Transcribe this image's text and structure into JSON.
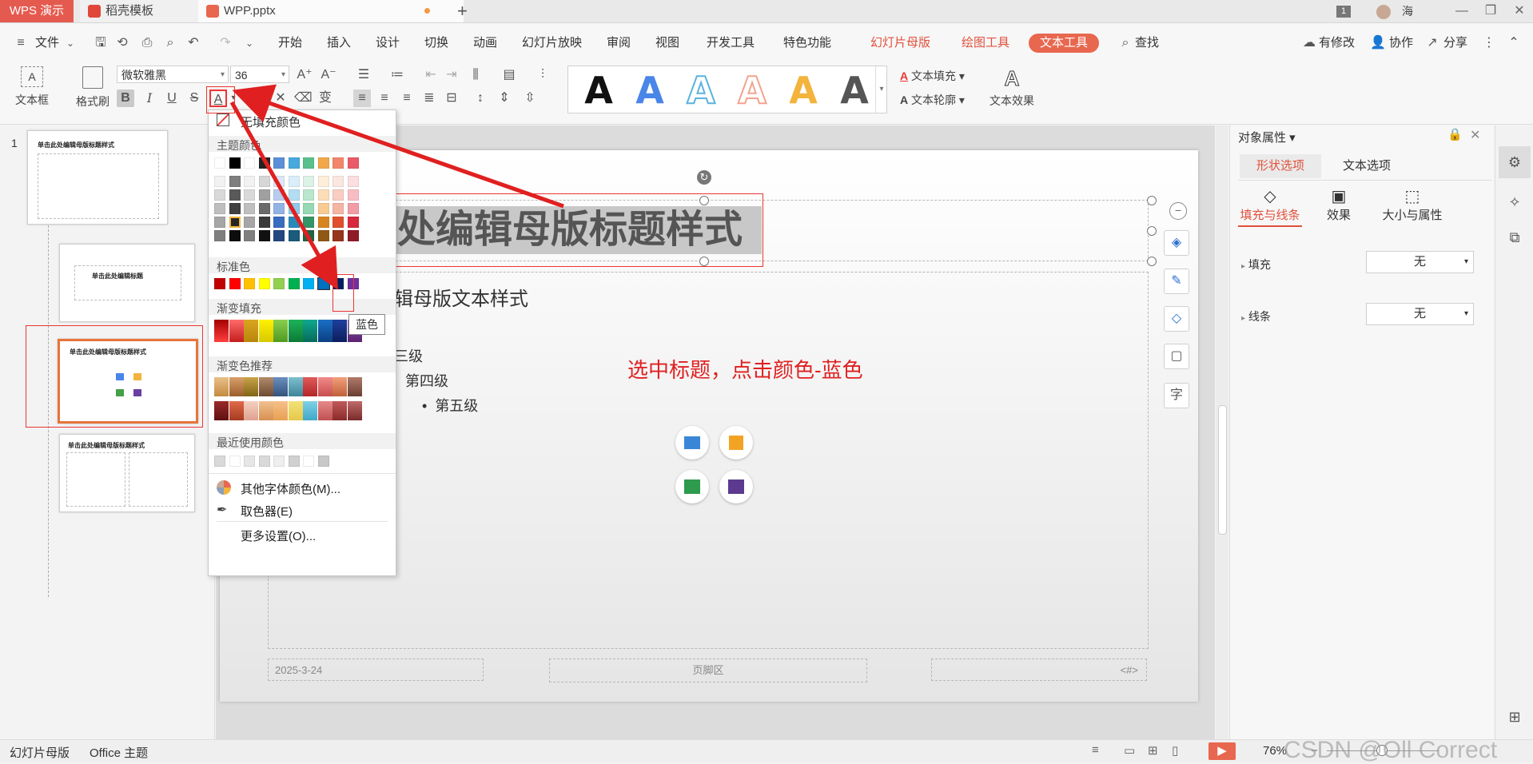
{
  "tabs": {
    "app": "WPS 演示",
    "template": "稻壳模板",
    "file": "WPP.pptx",
    "add": "+",
    "page_badge": "1",
    "user": "海"
  },
  "menu": {
    "file": "文件",
    "items": [
      "开始",
      "插入",
      "设计",
      "切换",
      "动画",
      "幻灯片放映",
      "审阅",
      "视图",
      "开发工具",
      "特色功能"
    ],
    "ctx_master": "幻灯片母版",
    "ctx_draw": "绘图工具",
    "ctx_text": "文本工具",
    "search": "查找",
    "right": [
      "有修改",
      "协作",
      "分享"
    ]
  },
  "ribbon": {
    "textbox": "文本框",
    "format_painter": "格式刷",
    "font_name": "微软雅黑",
    "font_size": "36",
    "bold": "B",
    "italic": "I",
    "underline": "U",
    "strike": "S",
    "font_color_letter": "A",
    "text_fill": "文本填充",
    "text_outline": "文本轮廓",
    "text_effect": "文本效果",
    "style_letter": "A",
    "style_colors": [
      "#111111",
      "#4a86e8",
      "#5bb3e0",
      "#f2a48e",
      "#f3b33d",
      "#555555"
    ]
  },
  "thumbs": {
    "num": "1",
    "master_title": "单击此处编辑母版标题样式",
    "layout2_title": "单击此处编辑标题",
    "layout3_title": "单击此处编辑母版标题样式",
    "layout4_title": "单击此处编辑母版标题样式"
  },
  "slide": {
    "title": "处编辑母版标题样式",
    "body_text": "辑母版文本样式",
    "level3": "三级",
    "level4": "第四级",
    "level5": "第五级",
    "annotation": "选中标题，点击颜色-蓝色",
    "footer_date": "2025-3-24",
    "footer_center": "页脚区",
    "footer_page": "<#>"
  },
  "dropdown": {
    "no_fill": "无填充颜色",
    "theme_colors": "主题颜色",
    "standard_colors": "标准色",
    "gradient_fill": "渐变填充",
    "gradient_recommend": "渐变色推荐",
    "recent_colors": "最近使用颜色",
    "more_font_colors": "其他字体颜色(M)...",
    "picker": "取色器(E)",
    "more_settings": "更多设置(O)...",
    "tooltip": "蓝色",
    "theme_top": [
      "#ffffff",
      "#000000",
      "#ffffff",
      "#222222",
      "#5b8fd8",
      "#47a9dc",
      "#59c08b",
      "#f2a84a",
      "#f2866a",
      "#ea5b6a"
    ],
    "theme_cols": [
      [
        "#f2f2f2",
        "#d9d9d9",
        "#bfbfbf",
        "#a6a6a6",
        "#7f7f7f"
      ],
      [
        "#7f7f7f",
        "#595959",
        "#404040",
        "#262626",
        "#0d0d0d"
      ],
      [
        "#f2f2f2",
        "#d9d9d9",
        "#bfbfbf",
        "#a6a6a6",
        "#7f7f7f"
      ],
      [
        "#d6d6d6",
        "#a0a0a0",
        "#6a6a6a",
        "#3a3a3a",
        "#111111"
      ],
      [
        "#dce6f6",
        "#b8cdee",
        "#93b3e5",
        "#3a6cbf",
        "#25477f"
      ],
      [
        "#d9eef8",
        "#b3ddf1",
        "#8dcbea",
        "#2a89b8",
        "#1b5b7b"
      ],
      [
        "#dcf2e6",
        "#b9e6cd",
        "#96d9b4",
        "#349566",
        "#226344"
      ],
      [
        "#fdeedb",
        "#fbddb7",
        "#f8cb93",
        "#d9851f",
        "#905815"
      ],
      [
        "#fce6e0",
        "#f9cdc1",
        "#f6b4a2",
        "#e0502b",
        "#95351c"
      ],
      [
        "#fbdee1",
        "#f7bdc3",
        "#f29ca6",
        "#d8293c",
        "#901b28"
      ]
    ],
    "standard": [
      "#c00000",
      "#ff0000",
      "#ffc000",
      "#ffff00",
      "#92d050",
      "#00b050",
      "#00b0f0",
      "#0070c0",
      "#002060",
      "#7030a0"
    ],
    "gradients": [
      [
        "#a50000",
        "#ff4040"
      ],
      [
        "#ff6b6b",
        "#c41e1e"
      ],
      [
        "#d9a520",
        "#b8860b"
      ],
      [
        "#fff200",
        "#d8c800"
      ],
      [
        "#8bcf4f",
        "#4f9a20"
      ],
      [
        "#1db35a",
        "#0b7a36"
      ],
      [
        "#0fa88f",
        "#066b5a"
      ],
      [
        "#1a6fc4",
        "#0b3f82"
      ],
      [
        "#1f3f9e",
        "#0c1d5c"
      ],
      [
        "#8e44ad",
        "#5b2370"
      ]
    ],
    "recommend_row1": [
      [
        "#e8c08a",
        "#c48a3e"
      ],
      [
        "#d9a06a",
        "#9a5e2b"
      ],
      [
        "#c9a44a",
        "#7f6414"
      ],
      [
        "#b38a6a",
        "#6d4a32"
      ],
      [
        "#6a8fbf",
        "#34527d"
      ],
      [
        "#7fbfcf",
        "#3d8597"
      ],
      [
        "#e05a5a",
        "#b32626"
      ],
      [
        "#f28a8a",
        "#c74d4d"
      ],
      [
        "#f2a07a",
        "#c0603a"
      ],
      [
        "#b07a6a",
        "#6b3f33"
      ]
    ],
    "recommend_row2": [
      [
        "#9a2a2a",
        "#5e1010"
      ],
      [
        "#e06a4a",
        "#a53a20"
      ],
      [
        "#f4d0c0",
        "#e0a090"
      ],
      [
        "#f0c090",
        "#d89050"
      ],
      [
        "#f6c08a",
        "#e8a050"
      ],
      [
        "#f2e27a",
        "#e6c84a"
      ],
      [
        "#7fd0e6",
        "#40a8c8"
      ],
      [
        "#e68a8a",
        "#c05050"
      ],
      [
        "#c05a5a",
        "#8a2a2a"
      ],
      [
        "#c06a6a",
        "#7a2a2a"
      ]
    ],
    "recent": [
      "#d9d9d9",
      "#ffffff",
      "#e6e6e6",
      "#d9d9d9",
      "#eeeeee",
      "#d0d0d0",
      "#ffffff",
      "#c8c8c8"
    ]
  },
  "rpanel": {
    "title": "对象属性",
    "tab_shape": "形状选项",
    "tab_text": "文本选项",
    "sub_fill_line": "填充与线条",
    "sub_effect": "效果",
    "sub_size": "大小与属性",
    "fill_label": "填充",
    "fill_value": "无",
    "line_label": "线条",
    "line_value": "无"
  },
  "status": {
    "master": "幻灯片母版",
    "theme": "Office 主题",
    "zoom": "76%",
    "watermark": "CSDN @Oll Correct"
  }
}
